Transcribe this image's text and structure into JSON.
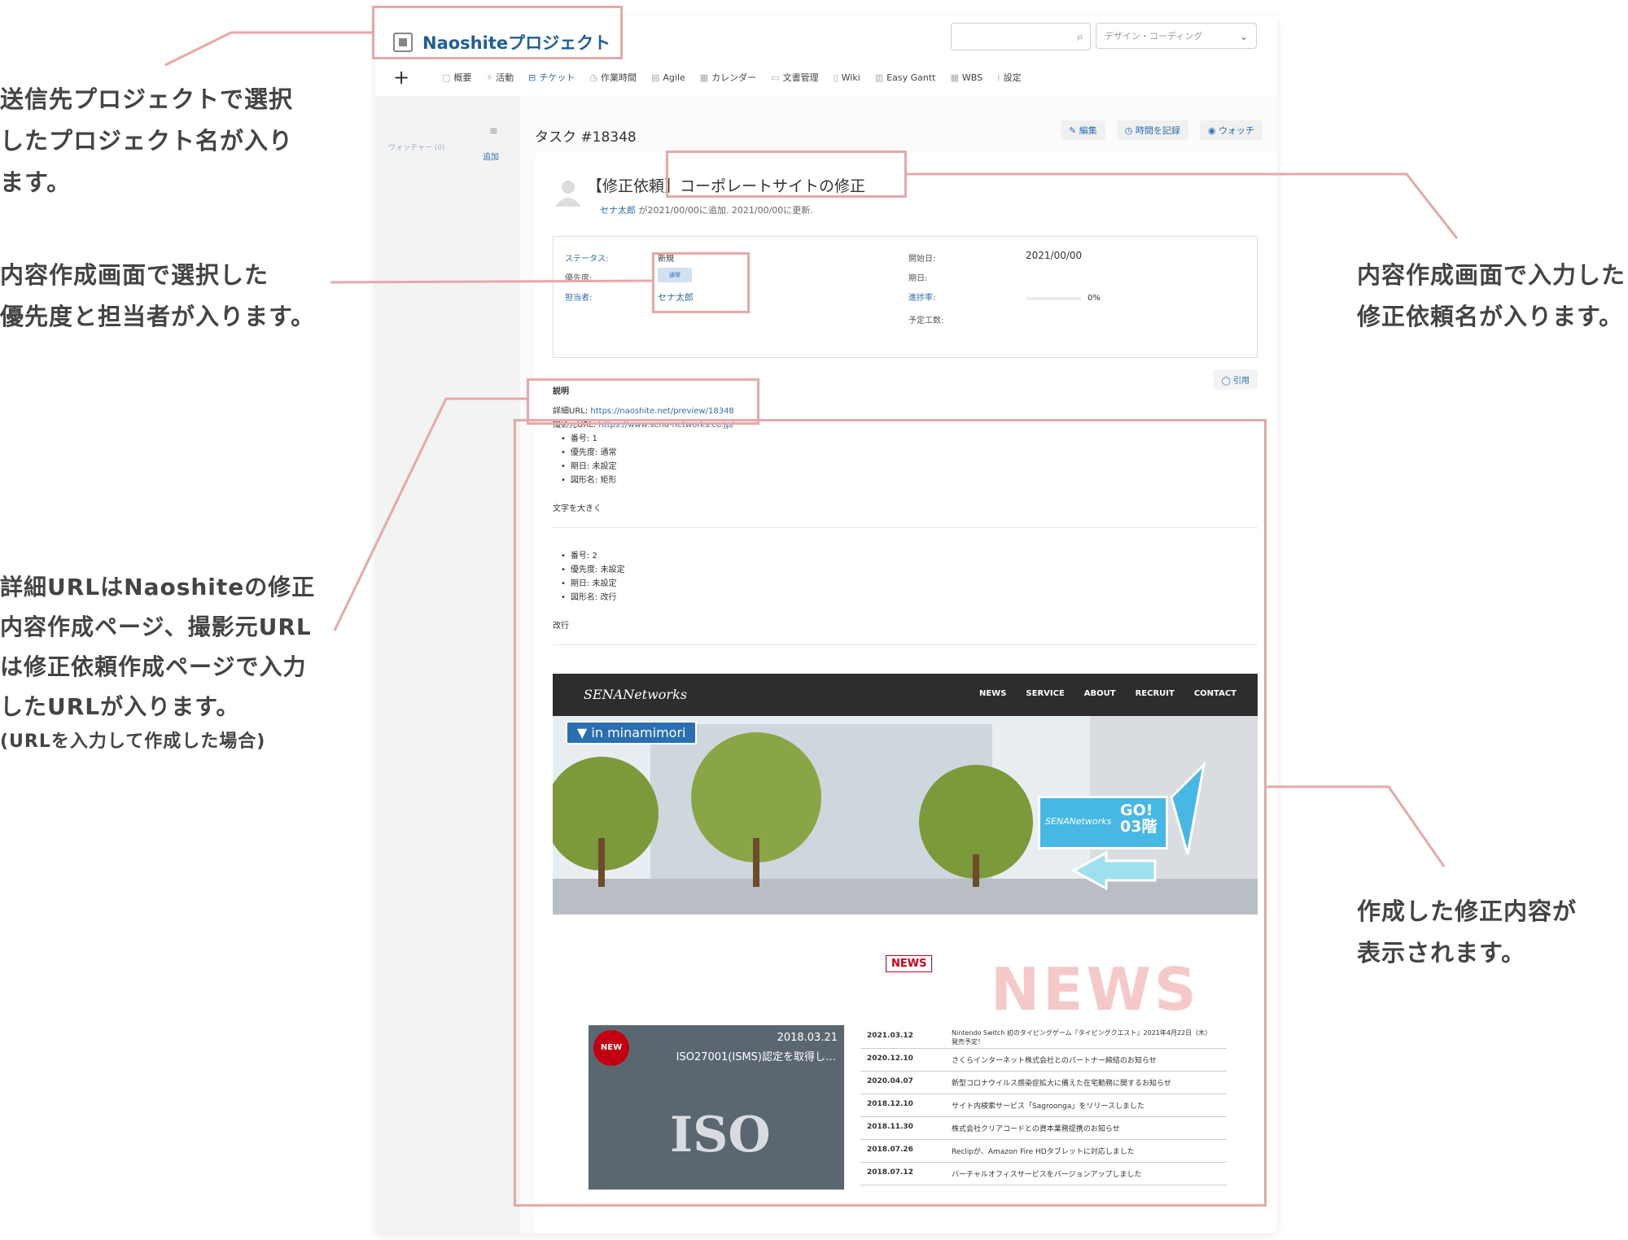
{
  "annotations": {
    "project_name": [
      "送信先プロジェクトで選択",
      "したプロジェクト名が入り",
      "ます。"
    ],
    "priority_assignee": [
      "内容作成画面で選択した",
      "優先度と担当者が入ります。"
    ],
    "subject": [
      "内容作成画面で入力した",
      "修正依頼名が入ります。"
    ],
    "urls": [
      "詳細URLはNaoshiteの修正",
      "内容作成ページ、撮影元URL",
      "は修正依頼作成ページで入力",
      "したURLが入ります。"
    ],
    "urls_note": "(URLを入力して作成した場合)",
    "content": [
      "作成した修正内容が",
      "表示されます。"
    ]
  },
  "header": {
    "project_name": "Naoshiteプロジェクト",
    "project_select": "デザイン・コーディング",
    "search_placeholder": ""
  },
  "menu": [
    {
      "label": "概要",
      "icon": "document-icon"
    },
    {
      "label": "活動",
      "icon": "activity-icon"
    },
    {
      "label": "チケット",
      "icon": "ticket-icon",
      "active": true
    },
    {
      "label": "作業時間",
      "icon": "clock-icon"
    },
    {
      "label": "Agile",
      "icon": "board-icon"
    },
    {
      "label": "カレンダー",
      "icon": "calendar-icon"
    },
    {
      "label": "文書管理",
      "icon": "folder-icon"
    },
    {
      "label": "Wiki",
      "icon": "wiki-icon"
    },
    {
      "label": "Easy Gantt",
      "icon": "gantt-icon"
    },
    {
      "label": "WBS",
      "icon": "wbs-icon"
    },
    {
      "label": "設定",
      "icon": "settings-icon"
    }
  ],
  "sidebar": {
    "watchers": "ウォッチャー (0)",
    "add": "追加"
  },
  "task": {
    "heading": "タスク #18348",
    "actions": {
      "edit": "編集",
      "log_time": "時間を記録",
      "watch": "ウォッチ"
    },
    "subject": "【修正依頼】コーポレートサイトの修正",
    "author": "セナ太郎",
    "author_meta": "が2021/00/00に追加. 2021/00/00に更新."
  },
  "attributes": {
    "status_label": "ステータス:",
    "status_value": "新規",
    "priority_label": "優先度:",
    "priority_value": "通常",
    "assignee_label": "担当者:",
    "assignee_value": "セナ太郎",
    "start_label": "開始日:",
    "start_value": "2021/00/00",
    "due_label": "期日:",
    "progress_label": "進捗率:",
    "progress_value": "0%",
    "progress_fraction": 0,
    "estimate_label": "予定工数:"
  },
  "description": {
    "heading": "説明",
    "quote": "引用",
    "detail_url_label": "詳細URL:",
    "detail_url": "https://naoshite.net/preview/18348",
    "source_url_label": "撮影元URL:",
    "source_url": "https://www.sena-networks.co.jp/",
    "items1": [
      "番号: 1",
      "優先度: 通常",
      "期日: 未設定",
      "図形名: 矩形"
    ],
    "text1": "文字を大きく",
    "items2": [
      "番号: 2",
      "優先度: 未設定",
      "期日: 未設定",
      "図形名: 改行"
    ],
    "text2": "改行"
  },
  "site": {
    "logo": "SENANetworks",
    "nav": [
      "NEWS",
      "SERVICE",
      "ABOUT",
      "RECRUIT",
      "CONTACT"
    ],
    "hero_tag": "▼ in minamimori",
    "go_logo": "SENANetworks",
    "go_text_1": "GO!",
    "go_text_2": "03階",
    "news_badge": "NEWS",
    "news_bg": "NEWS",
    "news_img_new": "NEW",
    "news_img_date": "2018.03.21",
    "news_img_title": "ISO27001(ISMS)認定を取得し…",
    "news_img_word": "ISO",
    "news": [
      {
        "date": "2021.03.12",
        "title": "Nintendo Switch 初のタイピングゲーム『タイピングクエスト』2021年4月22日（木）発売予定！"
      },
      {
        "date": "2020.12.10",
        "title": "さくらインターネット株式会社とのパートナー締結のお知らせ"
      },
      {
        "date": "2020.04.07",
        "title": "新型コロナウイルス感染症拡大に備えた在宅勤務に関するお知らせ"
      },
      {
        "date": "2018.12.10",
        "title": "サイト内検索サービス「Sagroonga」をリリースしました"
      },
      {
        "date": "2018.11.30",
        "title": "株式会社クリアコードとの資本業務提携のお知らせ"
      },
      {
        "date": "2018.07.26",
        "title": "Reclipが、Amazon Fire HDタブレットに対応しました"
      },
      {
        "date": "2018.07.12",
        "title": "バーチャルオフィスサービスをバージョンアップしました"
      }
    ]
  },
  "colors": {
    "highlight": "#e8a8a8",
    "link": "#2a6fb0"
  }
}
